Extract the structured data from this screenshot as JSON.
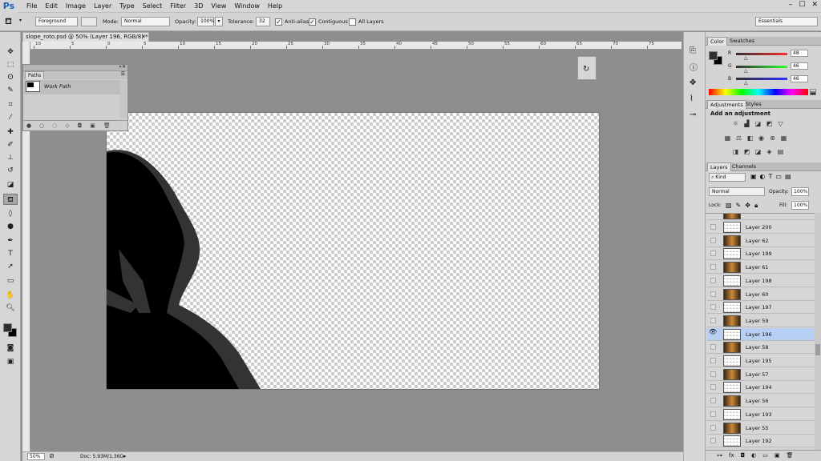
{
  "app": {
    "logo": "Ps"
  },
  "menu": [
    "File",
    "Edit",
    "Image",
    "Layer",
    "Type",
    "Select",
    "Filter",
    "3D",
    "View",
    "Window",
    "Help"
  ],
  "window_controls": [
    "–",
    "☐",
    "✕"
  ],
  "options": {
    "fill_source": "Foreground",
    "mode_label": "Mode:",
    "mode_value": "Normal",
    "opacity_label": "Opacity:",
    "opacity_value": "100%",
    "tolerance_label": "Tolerance:",
    "tolerance_value": "32",
    "antialias_label": "Anti-alias",
    "antialias_checked": true,
    "contiguous_label": "Contiguous",
    "contiguous_checked": true,
    "all_layers_label": "All Layers",
    "all_layers_checked": false,
    "workspace": "Essentials"
  },
  "document": {
    "tab_title": "slope_roto.psd @ 50% (Layer 196, RGB/8) *",
    "ruler_numbers": [
      "10",
      "5",
      "0",
      "5",
      "10",
      "15",
      "20",
      "25",
      "30",
      "35",
      "40",
      "45",
      "50",
      "55",
      "60",
      "65",
      "70",
      "75"
    ]
  },
  "paths_panel": {
    "tab": "Paths",
    "item": "Work Path"
  },
  "status": {
    "zoom": "50%",
    "doc": "Doc: 5.93M/1.36G"
  },
  "color_panel": {
    "tabs": [
      "Color",
      "Swatches"
    ],
    "r_label": "R",
    "r_value": "48",
    "g_label": "G",
    "g_value": "46",
    "b_label": "B",
    "b_value": "46"
  },
  "adjustments_panel": {
    "tabs": [
      "Adjustments",
      "Styles"
    ],
    "heading": "Add an adjustment"
  },
  "layers_panel": {
    "tabs": [
      "Layers",
      "Channels"
    ],
    "filter": "Kind",
    "blend_mode": "Normal",
    "opacity_label": "Opacity:",
    "opacity_value": "100%",
    "lock_label": "Lock:",
    "fill_label": "Fill:",
    "fill_value": "100%",
    "layers": [
      {
        "name": "Layer 200",
        "thumb": "mask",
        "visible": false,
        "selected": false
      },
      {
        "name": "Layer 62",
        "thumb": "img",
        "visible": false,
        "selected": false
      },
      {
        "name": "Layer 199",
        "thumb": "mask",
        "visible": false,
        "selected": false
      },
      {
        "name": "Layer 61",
        "thumb": "img",
        "visible": false,
        "selected": false
      },
      {
        "name": "Layer 198",
        "thumb": "mask",
        "visible": false,
        "selected": false
      },
      {
        "name": "Layer 60",
        "thumb": "img",
        "visible": false,
        "selected": false
      },
      {
        "name": "Layer 197",
        "thumb": "mask",
        "visible": false,
        "selected": false
      },
      {
        "name": "Layer 59",
        "thumb": "img",
        "visible": false,
        "selected": false
      },
      {
        "name": "Layer 196",
        "thumb": "mask",
        "visible": true,
        "selected": true
      },
      {
        "name": "Layer 58",
        "thumb": "img",
        "visible": false,
        "selected": false
      },
      {
        "name": "Layer 195",
        "thumb": "mask",
        "visible": false,
        "selected": false
      },
      {
        "name": "Layer 57",
        "thumb": "img",
        "visible": false,
        "selected": false
      },
      {
        "name": "Layer 194",
        "thumb": "mask",
        "visible": false,
        "selected": false
      },
      {
        "name": "Layer 56",
        "thumb": "img",
        "visible": false,
        "selected": false
      },
      {
        "name": "Layer 193",
        "thumb": "mask",
        "visible": false,
        "selected": false
      },
      {
        "name": "Layer 55",
        "thumb": "img",
        "visible": false,
        "selected": false
      },
      {
        "name": "Layer 192",
        "thumb": "mask",
        "visible": false,
        "selected": false
      }
    ],
    "footer_icons": [
      "link-icon",
      "fx-icon",
      "mask-icon",
      "adjustment-icon",
      "group-icon",
      "new-layer-icon",
      "trash-icon"
    ]
  }
}
